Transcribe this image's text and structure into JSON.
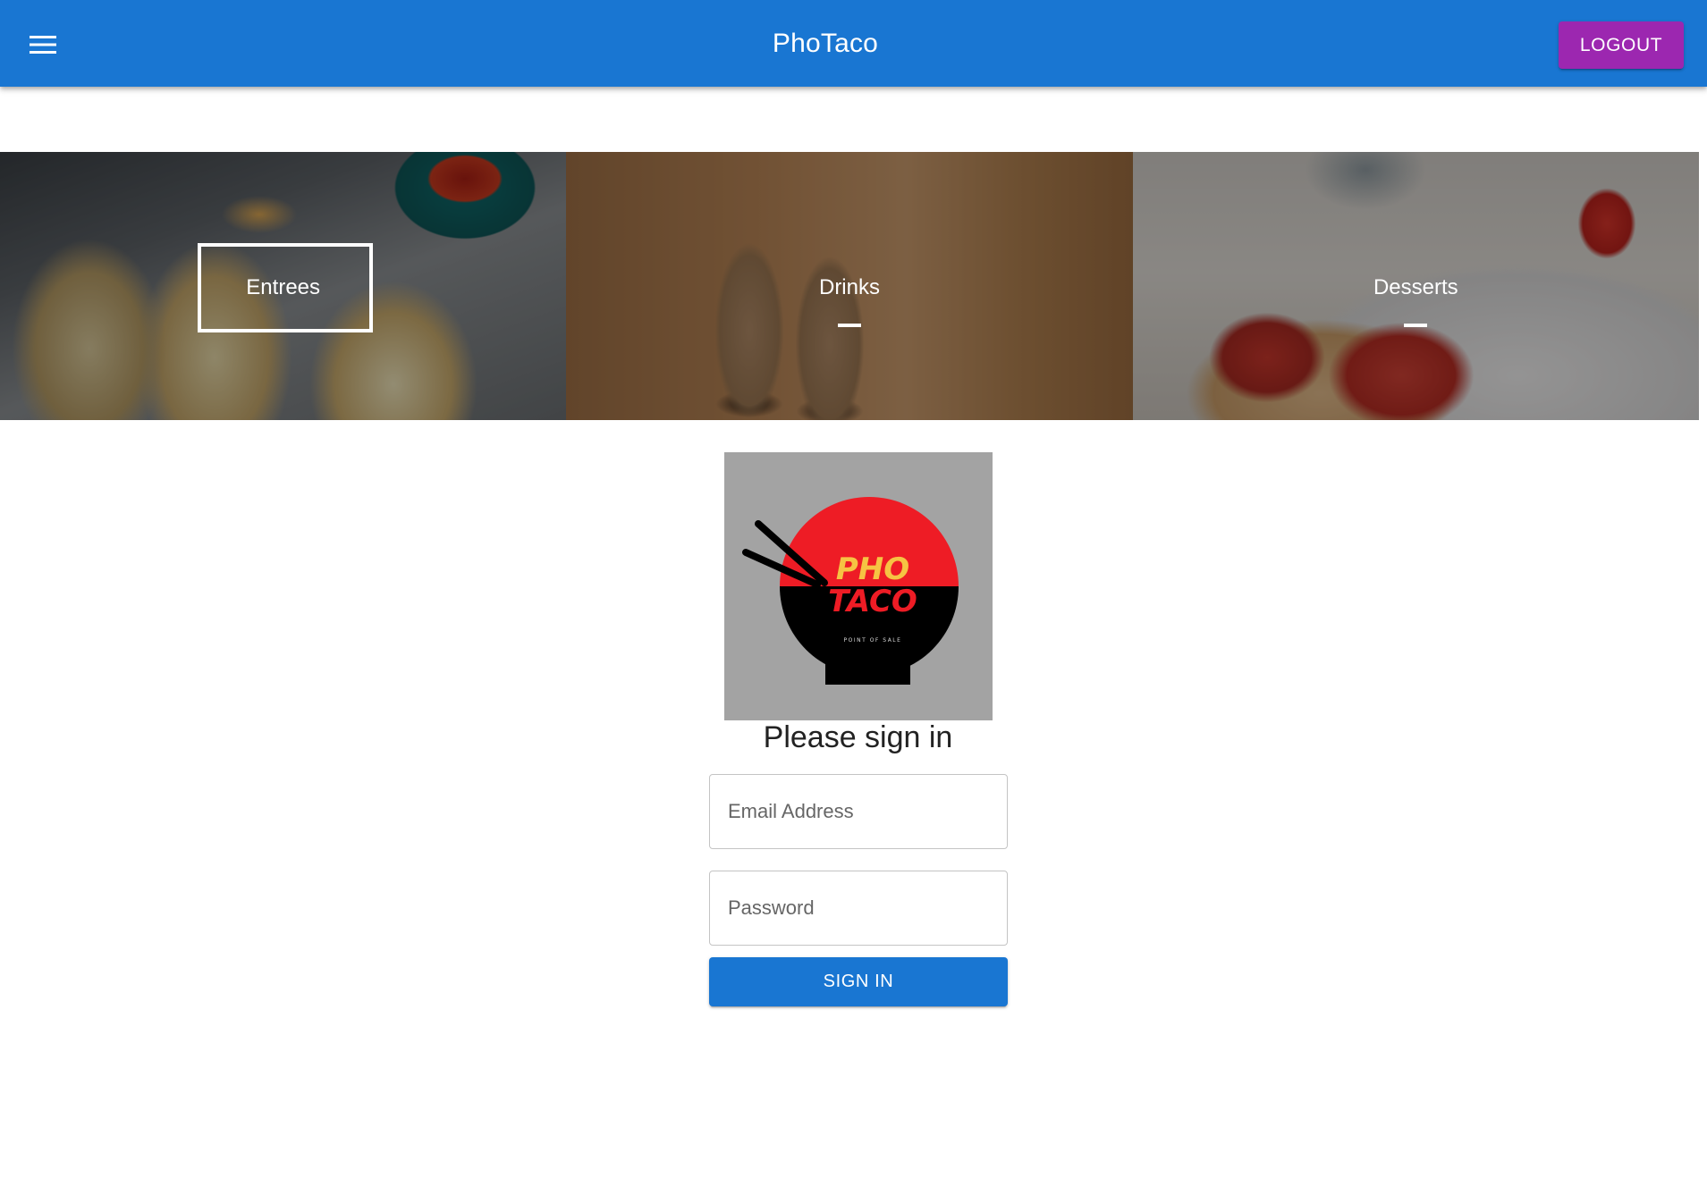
{
  "appbar": {
    "title": "PhoTaco",
    "menu_icon": "hamburger-menu-icon",
    "logout_label": "LOGOUT",
    "background": "#1976d2",
    "logout_color": "#9c27b0"
  },
  "categories": [
    {
      "label": "Entrees",
      "image": "tacos-photo",
      "focused": true
    },
    {
      "label": "Drinks",
      "image": "bubble-tea-photo",
      "focused": false
    },
    {
      "label": "Desserts",
      "image": "strawberry-tart-photo",
      "focused": false
    }
  ],
  "logo": {
    "line1": "PHO",
    "line2": "TACO",
    "tagline": "POINT OF SALE",
    "colors": {
      "background": "#a3a3a3",
      "red": "#ee1c25",
      "black": "#000000",
      "text": "#f6c343"
    }
  },
  "signin": {
    "title": "Please sign in",
    "email_placeholder": "Email Address",
    "email_value": "",
    "password_placeholder": "Password",
    "password_value": "",
    "submit_label": "SIGN IN"
  }
}
